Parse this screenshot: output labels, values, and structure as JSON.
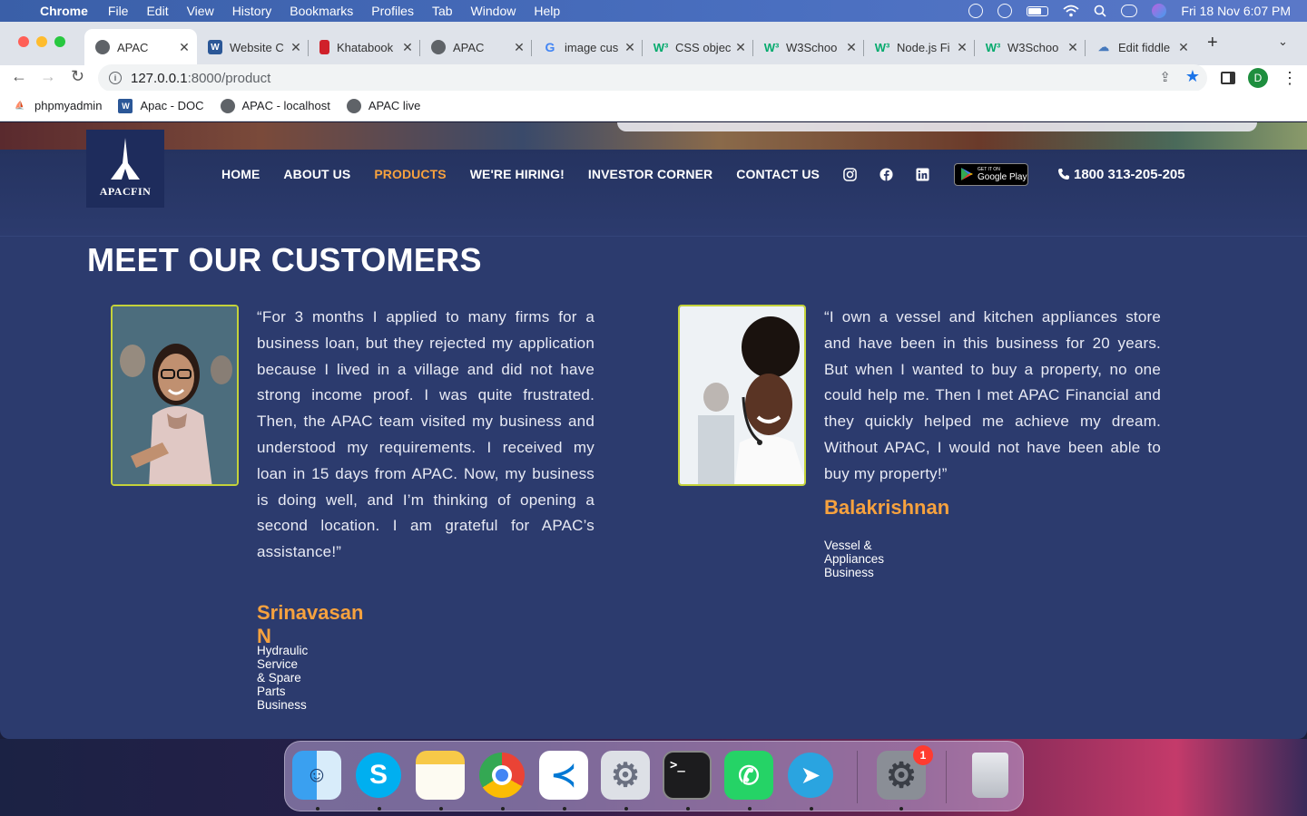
{
  "menubar": {
    "app_name": "Chrome",
    "items": [
      "File",
      "Edit",
      "View",
      "History",
      "Bookmarks",
      "Profiles",
      "Tab",
      "Window",
      "Help"
    ],
    "clock": "Fri 18 Nov  6:07 PM"
  },
  "tabs": [
    {
      "title": "APAC",
      "icon": "globe-icon",
      "active": true
    },
    {
      "title": "Website C",
      "icon": "word-icon"
    },
    {
      "title": "Khatabook",
      "icon": "khatabook-icon"
    },
    {
      "title": "APAC",
      "icon": "globe-icon"
    },
    {
      "title": "image cus",
      "icon": "google-icon"
    },
    {
      "title": "CSS objec",
      "icon": "w3schools-icon"
    },
    {
      "title": "W3Schoo",
      "icon": "w3schools-icon"
    },
    {
      "title": "Node.js Fi",
      "icon": "w3schools-icon"
    },
    {
      "title": "W3Schoo",
      "icon": "w3schools-icon"
    },
    {
      "title": "Edit fiddle",
      "icon": "jsfiddle-icon"
    }
  ],
  "toolbar": {
    "url_host": "127.0.0.1",
    "url_path": ":8000/product",
    "profile_initial": "D"
  },
  "bookmarks": [
    {
      "label": "phpmyadmin",
      "icon": "phpmyadmin-icon"
    },
    {
      "label": "Apac - DOC",
      "icon": "word-icon"
    },
    {
      "label": "APAC - localhost",
      "icon": "globe-icon"
    },
    {
      "label": "APAC live",
      "icon": "globe-icon"
    }
  ],
  "site": {
    "logo_text": "APACFIN",
    "nav": [
      {
        "label": "HOME",
        "active": false
      },
      {
        "label": "ABOUT US",
        "active": false
      },
      {
        "label": "PRODUCTS",
        "active": true
      },
      {
        "label": "WE'RE HIRING!",
        "active": false
      },
      {
        "label": "INVESTOR CORNER",
        "active": false
      },
      {
        "label": "CONTACT US",
        "active": false
      }
    ],
    "social_icons": [
      "instagram-icon",
      "facebook-icon",
      "linkedin-icon"
    ],
    "google_play": {
      "small": "GET IT ON",
      "big": "Google Play"
    },
    "phone": "1800 313-205-205",
    "accent_color": "#f7a23e",
    "background_color": "#2c3b6e"
  },
  "customers": {
    "title": "MEET OUR CUSTOMERS",
    "items": [
      {
        "quote": "“For 3 months I applied to many firms for a business loan, but they rejected my application because I lived in a village and did not have strong income proof. I was quite frustrated. Then, the APAC team visited my business and understood my requirements. I received my loan in 15 days from APAC. Now, my business is doing well, and I’m thinking of opening a second location. I am grateful for APAC’s assistance!”",
        "name": "Srinavasan N",
        "business": "Hydraulic Service & Spare Parts Business"
      },
      {
        "quote": "“I own a vessel and kitchen appliances store and have been in this business for 20 years. But when I wanted to buy a property, no one could help me. Then I met APAC Financial and they quickly helped me achieve my dream. Without APAC, I would not have been able to buy my property!”",
        "name": "Balakrishnan",
        "business": "Vessel & Appliances Business"
      }
    ]
  },
  "dock": {
    "apps": [
      "finder-icon",
      "skype-icon",
      "notes-icon",
      "chrome-icon",
      "vscode-icon",
      "preferences-icon",
      "terminal-icon",
      "whatsapp-icon",
      "telegram-icon",
      "system-settings-icon",
      "trash-icon"
    ],
    "settings_badge": "1"
  }
}
